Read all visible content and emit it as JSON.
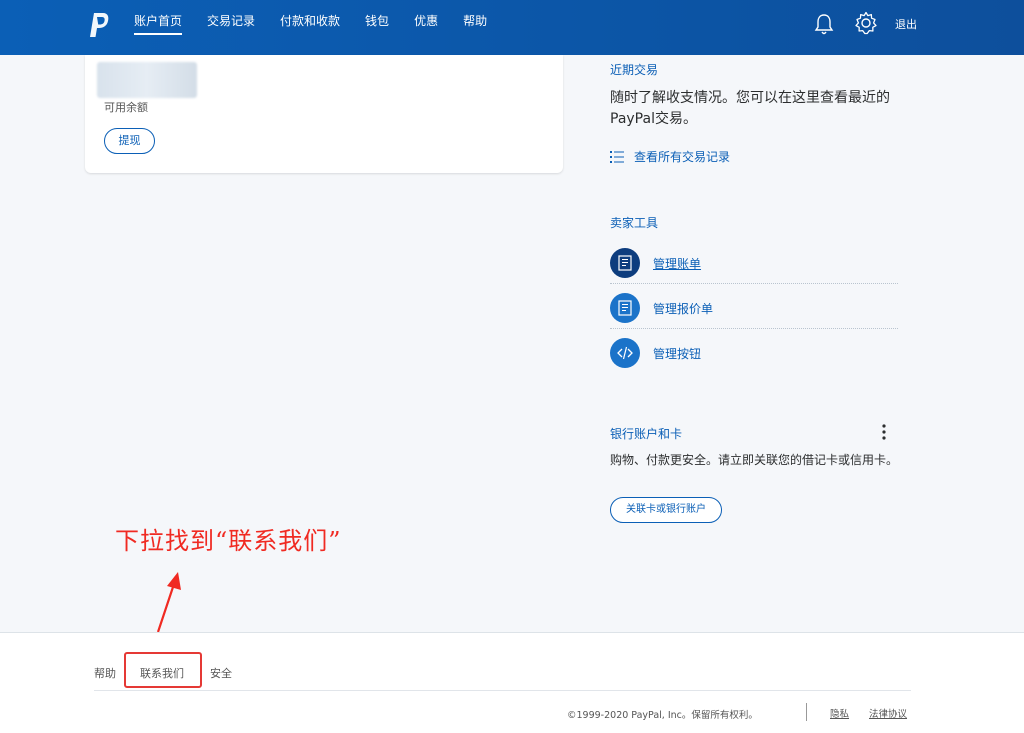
{
  "header": {
    "nav": [
      "账户首页",
      "交易记录",
      "付款和收款",
      "钱包",
      "优惠",
      "帮助"
    ],
    "logout": "退出"
  },
  "balance_card": {
    "available_label": "可用余额",
    "withdraw_button": "提现"
  },
  "recent": {
    "title": "近期交易",
    "description": "随时了解收支情况。您可以在这里查看最近的PayPal交易。",
    "view_all": "查看所有交易记录"
  },
  "seller_tools": {
    "title": "卖家工具",
    "items": [
      "管理账单",
      "管理报价单",
      "管理按钮"
    ]
  },
  "bank": {
    "title": "银行账户和卡",
    "description": "购物、付款更安全。请立即关联您的借记卡或信用卡。",
    "link_button": "关联卡或银行账户"
  },
  "annotation": "下拉找到“联系我们”",
  "footer": {
    "links": [
      "帮助",
      "联系我们",
      "安全"
    ],
    "copyright": "©1999-2020 PayPal, Inc。保留所有权利。",
    "privacy": "隐私",
    "legal": "法律协议"
  },
  "colors": {
    "brand_blue": "#0b5fb6",
    "dark_blue": "#0d3d7e",
    "annotation_red": "#f02a22"
  },
  "icons": [
    "paypal-logo",
    "bell-icon",
    "gear-icon",
    "list-icon",
    "invoice-icon",
    "quote-icon",
    "code-icon",
    "kebab-icon"
  ]
}
